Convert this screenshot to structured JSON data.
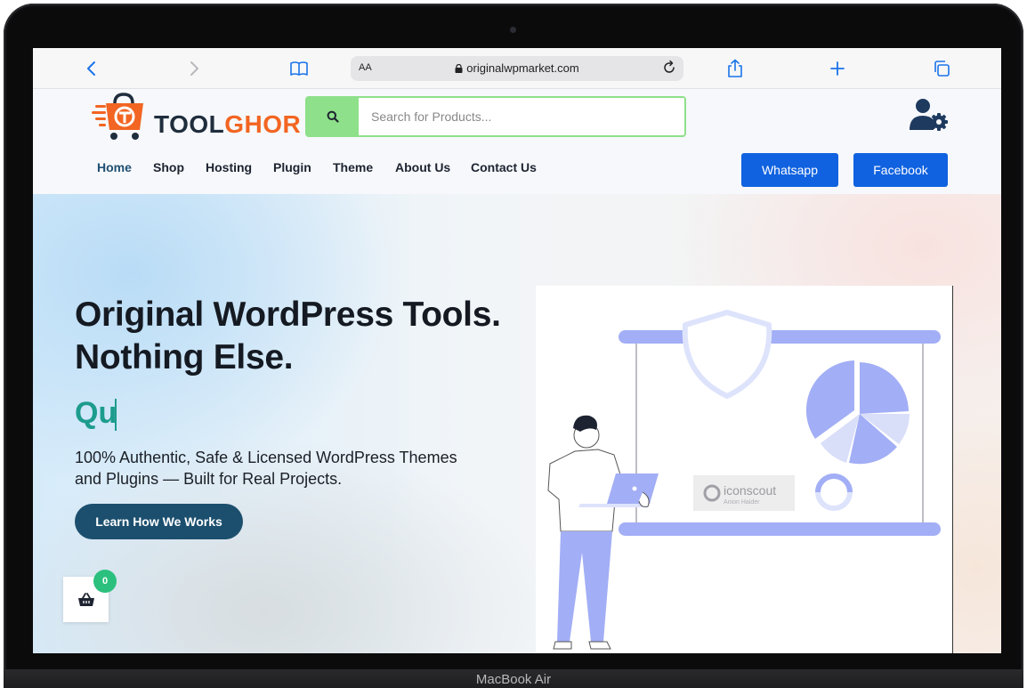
{
  "device": {
    "label": "MacBook Air"
  },
  "browser": {
    "url": "originalwpmarket.com",
    "text_size_label": "AA",
    "icons": [
      "chevron-left-icon",
      "chevron-right-icon",
      "book-icon",
      "lock-icon",
      "reload-icon",
      "share-icon",
      "plus-icon",
      "tabs-icon"
    ]
  },
  "header": {
    "logo_part1": "TOOL",
    "logo_part2": "GHOR",
    "search_placeholder": "Search for Products...",
    "nav": [
      {
        "label": "Home",
        "active": true
      },
      {
        "label": "Shop",
        "active": false
      },
      {
        "label": "Hosting",
        "active": false
      },
      {
        "label": "Plugin",
        "active": false
      },
      {
        "label": "Theme",
        "active": false
      },
      {
        "label": "About Us",
        "active": false
      },
      {
        "label": "Contact Us",
        "active": false
      }
    ],
    "buttons": {
      "whatsapp": "Whatsapp",
      "facebook": "Facebook"
    }
  },
  "hero": {
    "title_line1": "Original WordPress Tools.",
    "title_line2": "Nothing Else.",
    "typed_text": "Qu",
    "subtitle_line1": "100% Authentic, Safe & Licensed WordPress Themes",
    "subtitle_line2": "and Plugins — Built for Real Projects.",
    "cta_label": "Learn How We Works",
    "illustration_watermark": "iconscout",
    "illustration_watermark_sub": "Anion Haider"
  },
  "cart": {
    "count": "0"
  },
  "colors": {
    "brand_orange": "#f26522",
    "brand_dark": "#1f2d3d",
    "search_green": "#8ee08a",
    "button_blue": "#1062e0",
    "cta_teal": "#1c4f6e",
    "typed_teal": "#1d9c8d",
    "illustration_periwinkle": "#a2aef5",
    "badge_green": "#2bc07d"
  }
}
